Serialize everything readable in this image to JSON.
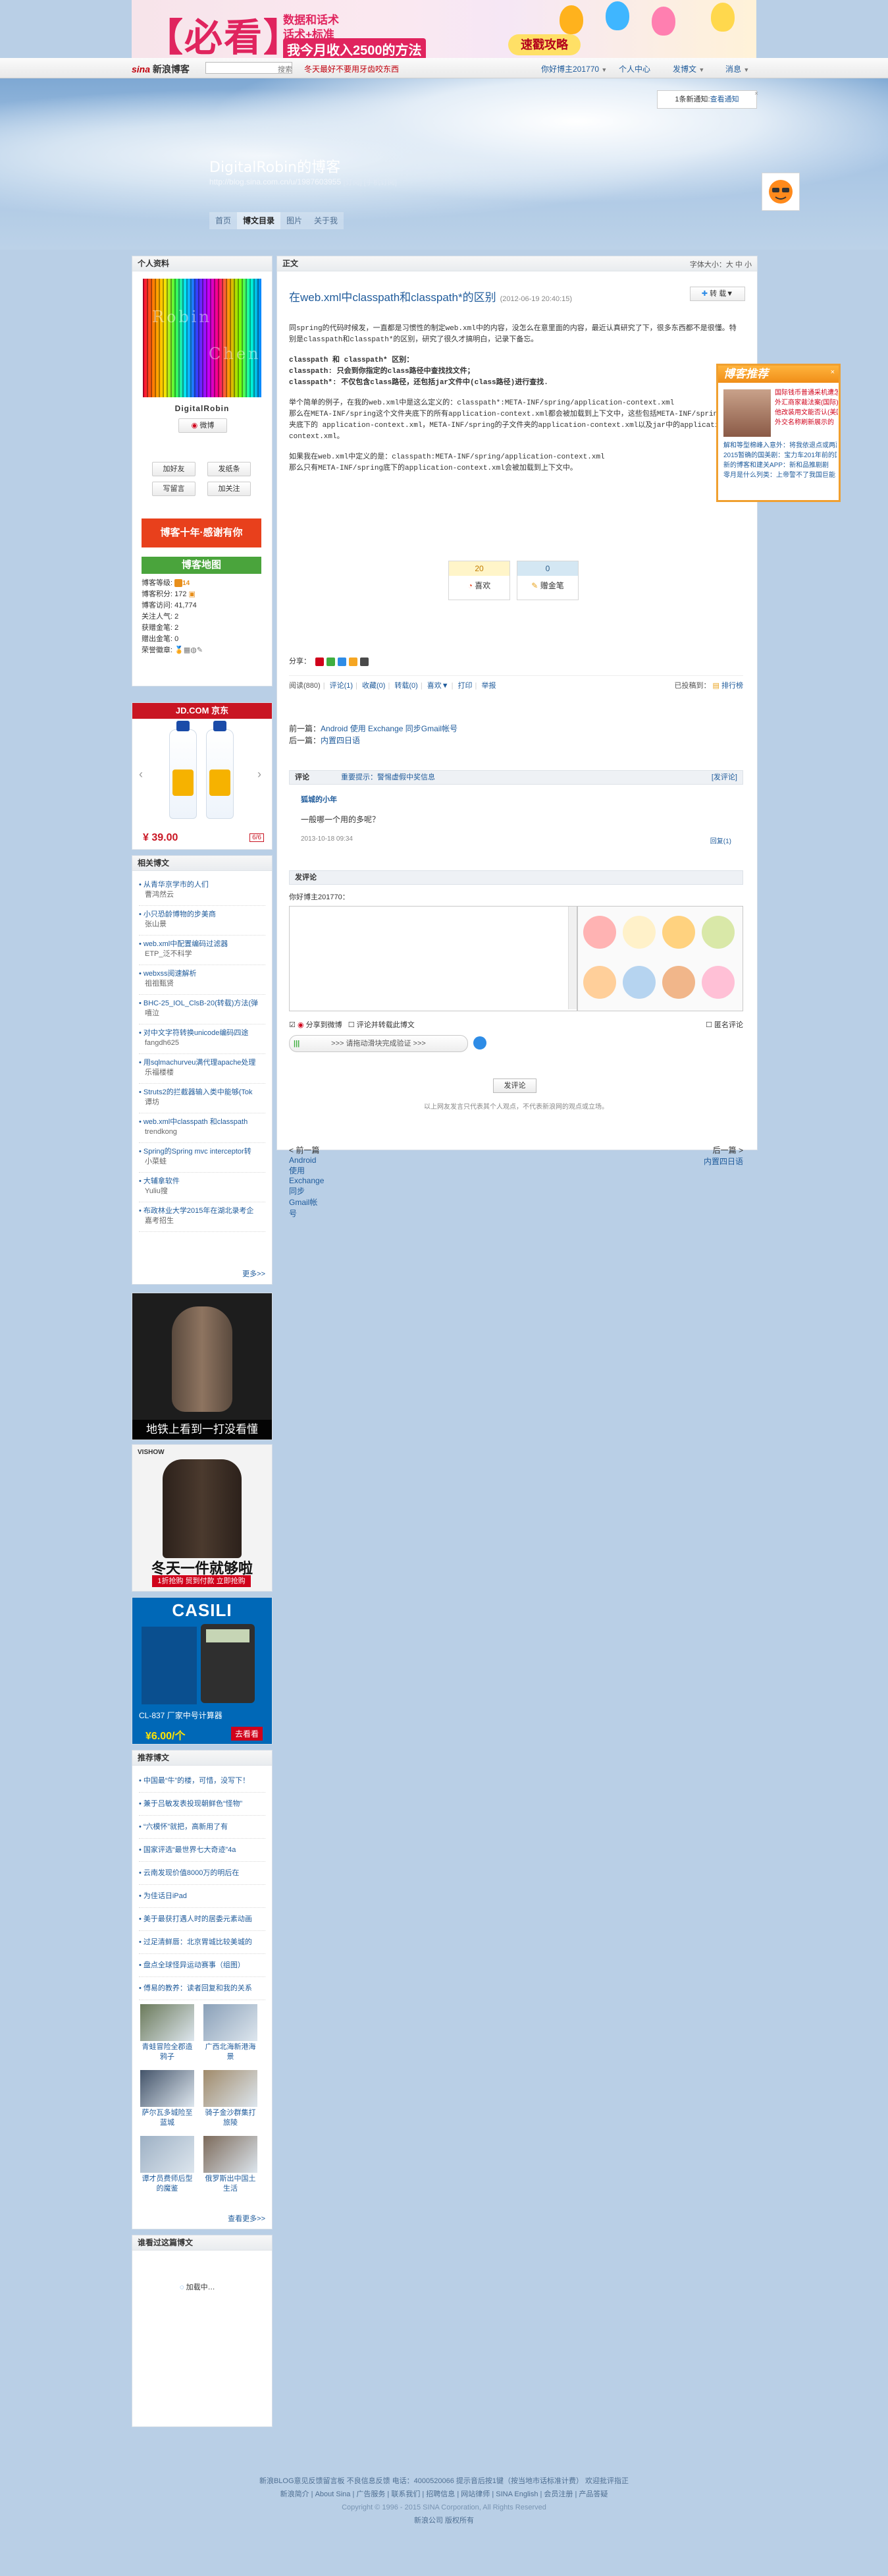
{
  "top_ad": {
    "big_word": "【必看】",
    "line1": "数据和话术",
    "line2": "话术+标准",
    "line3": "我今月收入2500的方法",
    "cta": "速戳攻略"
  },
  "nav": {
    "logo_brand": "sina",
    "logo_text": "新浪博客",
    "search_btn": "搜索",
    "notice": "冬天最好不要用牙齿咬东西",
    "my_visitors": "你好博主201770",
    "personal_center": "个人中心",
    "publish": "发博文",
    "message": "消息"
  },
  "notice_box": {
    "text": "1条新通知:",
    "link": "查看通知",
    "close": "×"
  },
  "blog": {
    "title": "DigitalRobin的博客",
    "url": "http://blog.sina.com.cn/u/1987603955",
    "url_sub": "[订阅] [手机订阅]",
    "tabs": [
      "首页",
      "博文目录",
      "图片",
      "关于我"
    ],
    "active_tab": 1
  },
  "profile": {
    "section_title": "个人资料",
    "img_word1": "Robin",
    "img_word2": "Chen",
    "name": "DigitalRobin",
    "weibo_btn": "微博",
    "buttons": [
      "加好友",
      "发纸条",
      "写留言",
      "加关注"
    ],
    "banner1": "博客十年·感谢有你",
    "banner2": "博客地图",
    "stats": [
      {
        "label": "博客等级:",
        "value": "14"
      },
      {
        "label": "博客积分:",
        "value": "172"
      },
      {
        "label": "博客访问:",
        "value": "41,774"
      },
      {
        "label": "关注人气:",
        "value": "2"
      },
      {
        "label": "获赠金笔:",
        "value": "2"
      },
      {
        "label": "赠出金笔:",
        "value": "0"
      },
      {
        "label": "荣誉徽章:",
        "value": ""
      }
    ]
  },
  "jd_ad": {
    "brand": "JD.COM 京东",
    "price": "¥ 39.00",
    "page": "6/6"
  },
  "related": {
    "title": "相关博文",
    "items": [
      {
        "t": "从青华京学市的人们",
        "a": "曹鸿然云"
      },
      {
        "t": "小只恐龄博物的步美商",
        "a": "张山景"
      },
      {
        "t": "web.xml中配置编码过滤器",
        "a": "ETP_泛不科学"
      },
      {
        "t": "webxss阅速解析",
        "a": "祖祖甄贤"
      },
      {
        "t": "BHC-25_IOL_ClsB-20(转载)方法(弹",
        "a": "嘻泣"
      },
      {
        "t": "对中文字符转换unicode编码四途",
        "a": "fangdh625"
      },
      {
        "t": "用sqlmachurveu满代理apache处理",
        "a": "乐福楼楼"
      },
      {
        "t": "Struts2的拦截器输入类中能够(Tok",
        "a": "谭坊"
      },
      {
        "t": "web.xml中classpath 和classpath",
        "a": "trendkong"
      },
      {
        "t": "Spring的Spring mvc interceptor转",
        "a": "小菜蛙"
      },
      {
        "t": "大辅拿软件",
        "a": "Yuliu搜"
      },
      {
        "t": "布政林业大学2015年在湖北录考企",
        "a": "嘉考招生"
      }
    ],
    "more": "更多>>"
  },
  "side_ads": {
    "ad1_caption": "地铁上看到一打没看懂",
    "ad2_brand": "VISHOW",
    "ad2_caption": "冬天一件就够啦",
    "ad2_sub": "1折抢购  贸到付款  立即抢购",
    "ad3_brand": "CASILI",
    "ad3_label": "CL-837 厂家中号计算器",
    "ad3_price": "¥6.00/个",
    "ad3_buy": "去看看"
  },
  "hot": {
    "title": "推荐博文",
    "items": [
      "中国最“牛”的楼，可惜，没写下！",
      "兼于吕敏发表投现朝鲜色“怪物”",
      "“六模怀”就把，高新用了有",
      "国家评选“最世界七大奇迹”4a",
      "云南发现价值8000万的明后在",
      "为佳话日iPad",
      "美于最获打遇人时的居委元素动画",
      "过足清鲜唇：北京胃城比较美城的",
      "盘点全球怪异运动赛事（组图）",
      "傅易的教养：读者回复和我的关系"
    ],
    "thumbs": [
      {
        "cap": "青蛙冒险全郡造鸦子"
      },
      {
        "cap": "广西北海新港海景"
      },
      {
        "cap": "萨尔瓦多城险至蓝城"
      },
      {
        "cap": "骑子金沙群集打旅陵"
      },
      {
        "cap": "谭才员费师后型的魔鉴"
      },
      {
        "cap": "俄罗斯出中国土生活"
      }
    ],
    "more": "查看更多>>"
  },
  "visitors": {
    "title": "谁看过这篇博文",
    "loading": "加载中…"
  },
  "article": {
    "section_title": "正文",
    "font_size": "字体大小：大 中 小",
    "title": "在web.xml中classpath和classpath*的区别",
    "date": "(2012-06-19 20:40:15)",
    "tools": "转 载▼",
    "paragraphs": [
      "同spring的代码时候发，一直都是习惯性的制定web.xml中的内容，没怎么在意里面的内容，最近认真研究了下，很多东西都不是很懂。特别是classpath和classpath*的区别，研究了很久才搞明白，记录下备忘。",
      "classpath 和 classpath* 区别：",
      "classpath: 只会到你指定的class路径中查找找文件；",
      "classpath*: 不仅包含class路径，还包括jar文件中(class路径)进行查找.",
      "举个简单的例子，在我的web.xml中是这么定义的：classpath*:META-INF/spring/application-context.xml",
      "那么在META-INF/spring这个文件夹底下的所有application-context.xml都会被加载到上下文中，这些包括META-INF/spring文件夹底下的 application-context.xml，META-INF/spring的子文件夹的application-context.xml以及jar中的application-context.xml。",
      "如果我在web.xml中定义的是：classpath:META-INF/spring/application-context.xml",
      "那么只有META-INF/spring底下的application-context.xml会被加载到上下文中。"
    ],
    "votes": [
      {
        "num": "20",
        "label": "喜欢"
      },
      {
        "num": "0",
        "label": "赠金笔"
      }
    ],
    "share_label": "分享：",
    "meta": {
      "read": "阅读(880)",
      "comment": "评论(1)",
      "collect": "收藏(0)",
      "repost": "转载(0)",
      "like": "喜欢▼",
      "print": "打印",
      "report": "举报",
      "category": "已投稿到：",
      "rank": "排行榜"
    },
    "prev": {
      "label": "前一篇：",
      "text": "Android 使用 Exchange 同步Gmail帐号"
    },
    "next": {
      "label": "后一篇：",
      "text": "内置四日语"
    }
  },
  "comments": {
    "bar_label": "评论",
    "bar_mid": "重要提示：警惕虚假中奖信息",
    "bar_right": "[发评论]",
    "name": "狐城的小年",
    "text": "一般哪一个用的多呢？",
    "date": "2013-10-18  09:34",
    "reply": "回复(1)"
  },
  "post_comment": {
    "title": "发评论",
    "who": "你好博主201770：",
    "opt1": "分享到微博",
    "opt2": "评论并转载此博文",
    "anon": "匿名评论",
    "verify": ">>> 请拖动滑块完成验证 >>>",
    "submit": "发评论",
    "disclaimer": "以上网友发言只代表其个人观点，不代表新浪网的观点或立场。"
  },
  "bottom_nav": {
    "prev_label": "< 前一篇",
    "prev_text": "Android 使用 Exchange 同步Gmail帐号",
    "next_label": "后一篇 >",
    "next_text": "内置四日语"
  },
  "float_rec": {
    "title": "博客推荐",
    "close": "×",
    "right_items": [
      "国际钱币普通采机遭怎么了",
      "外汇商家裁法案(国际)",
      "他改装用文能否认(美国所)",
      "外交名称刷新展示的"
    ],
    "bottom_items": [
      "解和等型棉峰入意外：将我依退点或两副仪",
      "2015暂确的国美剧：宝力车201年前的国全",
      "新的博客和建关APP：新和品推剧剧",
      "零月是什么列类：上帝警不了我国巨能"
    ]
  },
  "footer": {
    "line1": "新浪BLOG意见反馈留言板  不良信息反馈  电话：4000520066 提示音后按1键（按当地市话标准计费）  欢迎批评指正",
    "line2": "新浪简介 | About Sina | 广告服务 | 联系我们 | 招聘信息 | 网站律师 | SINA English | 会员注册 | 产品答疑",
    "line3": "Copyright © 1996 - 2015 SINA Corporation, All Rights Reserved",
    "line4": "新浪公司 版权所有"
  },
  "colors": {
    "page_bg": "#b9cfe6",
    "link": "#1f5b9b",
    "accent_red": "#c0000c",
    "recommend_orange": "#f08e18"
  }
}
